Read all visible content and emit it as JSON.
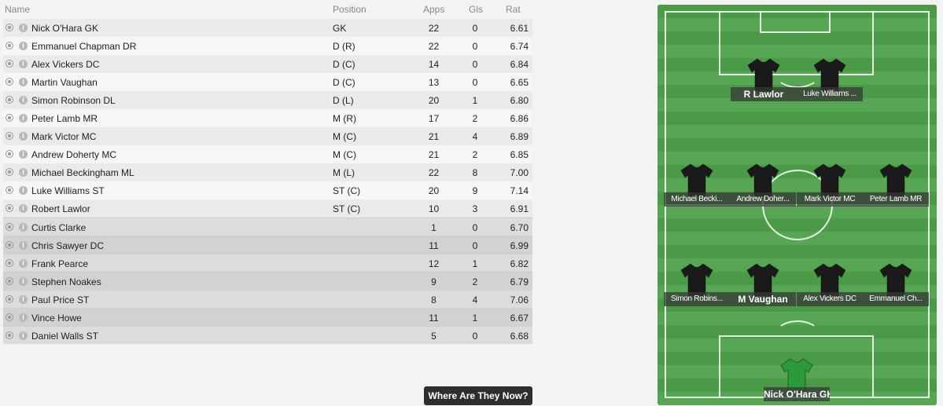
{
  "table": {
    "headers": {
      "name": "Name",
      "position": "Position",
      "apps": "Apps",
      "gls": "Gls",
      "rat": "Rat"
    },
    "starters": [
      {
        "name": "Nick O'Hara GK",
        "position": "GK",
        "apps": "22",
        "gls": "0",
        "rat": "6.61"
      },
      {
        "name": "Emmanuel Chapman DR",
        "position": "D (R)",
        "apps": "22",
        "gls": "0",
        "rat": "6.74"
      },
      {
        "name": "Alex Vickers DC",
        "position": "D (C)",
        "apps": "14",
        "gls": "0",
        "rat": "6.84"
      },
      {
        "name": "Martin Vaughan",
        "position": "D (C)",
        "apps": "13",
        "gls": "0",
        "rat": "6.65"
      },
      {
        "name": "Simon Robinson DL",
        "position": "D (L)",
        "apps": "20",
        "gls": "1",
        "rat": "6.80"
      },
      {
        "name": "Peter Lamb MR",
        "position": "M (R)",
        "apps": "17",
        "gls": "2",
        "rat": "6.86"
      },
      {
        "name": "Mark Victor MC",
        "position": "M (C)",
        "apps": "21",
        "gls": "4",
        "rat": "6.89"
      },
      {
        "name": "Andrew Doherty MC",
        "position": "M (C)",
        "apps": "21",
        "gls": "2",
        "rat": "6.85"
      },
      {
        "name": "Michael Beckingham ML",
        "position": "M (L)",
        "apps": "22",
        "gls": "8",
        "rat": "7.00"
      },
      {
        "name": "Luke Williams ST",
        "position": "ST (C)",
        "apps": "20",
        "gls": "9",
        "rat": "7.14"
      },
      {
        "name": "Robert Lawlor",
        "position": "ST (C)",
        "apps": "10",
        "gls": "3",
        "rat": "6.91"
      }
    ],
    "subs": [
      {
        "name": "Curtis Clarke",
        "position": "",
        "apps": "1",
        "gls": "0",
        "rat": "6.70"
      },
      {
        "name": "Chris Sawyer DC",
        "position": "",
        "apps": "11",
        "gls": "0",
        "rat": "6.99"
      },
      {
        "name": "Frank Pearce",
        "position": "",
        "apps": "12",
        "gls": "1",
        "rat": "6.82"
      },
      {
        "name": "Stephen Noakes",
        "position": "",
        "apps": "9",
        "gls": "2",
        "rat": "6.79"
      },
      {
        "name": "Paul Price ST",
        "position": "",
        "apps": "8",
        "gls": "4",
        "rat": "7.06"
      },
      {
        "name": "Vince Howe",
        "position": "",
        "apps": "11",
        "gls": "1",
        "rat": "6.67"
      },
      {
        "name": "Daniel Walls ST",
        "position": "",
        "apps": "5",
        "gls": "0",
        "rat": "6.68"
      }
    ],
    "info_glyph": "i"
  },
  "buttons": {
    "where_are_they_now": "Where Are They Now?"
  },
  "pitch": {
    "players": {
      "st_left": "R Lawlor",
      "st_right": "Luke Williams ...",
      "ml": "Michael Becki...",
      "mcl": "Andrew Doher...",
      "mcr": "Mark Victor MC",
      "mr": "Peter Lamb MR",
      "dl": "Simon Robins...",
      "dcl": "M Vaughan",
      "dcr": "Alex Vickers DC",
      "dr": "Emmanuel Ch...",
      "gk": "Nick O'Hara GK"
    },
    "colors": {
      "outfield_shirt": "#1a1a1a",
      "gk_shirt": "#2c9a3a",
      "grass_light": "#56a653",
      "grass_dark": "#4b9a48"
    }
  }
}
